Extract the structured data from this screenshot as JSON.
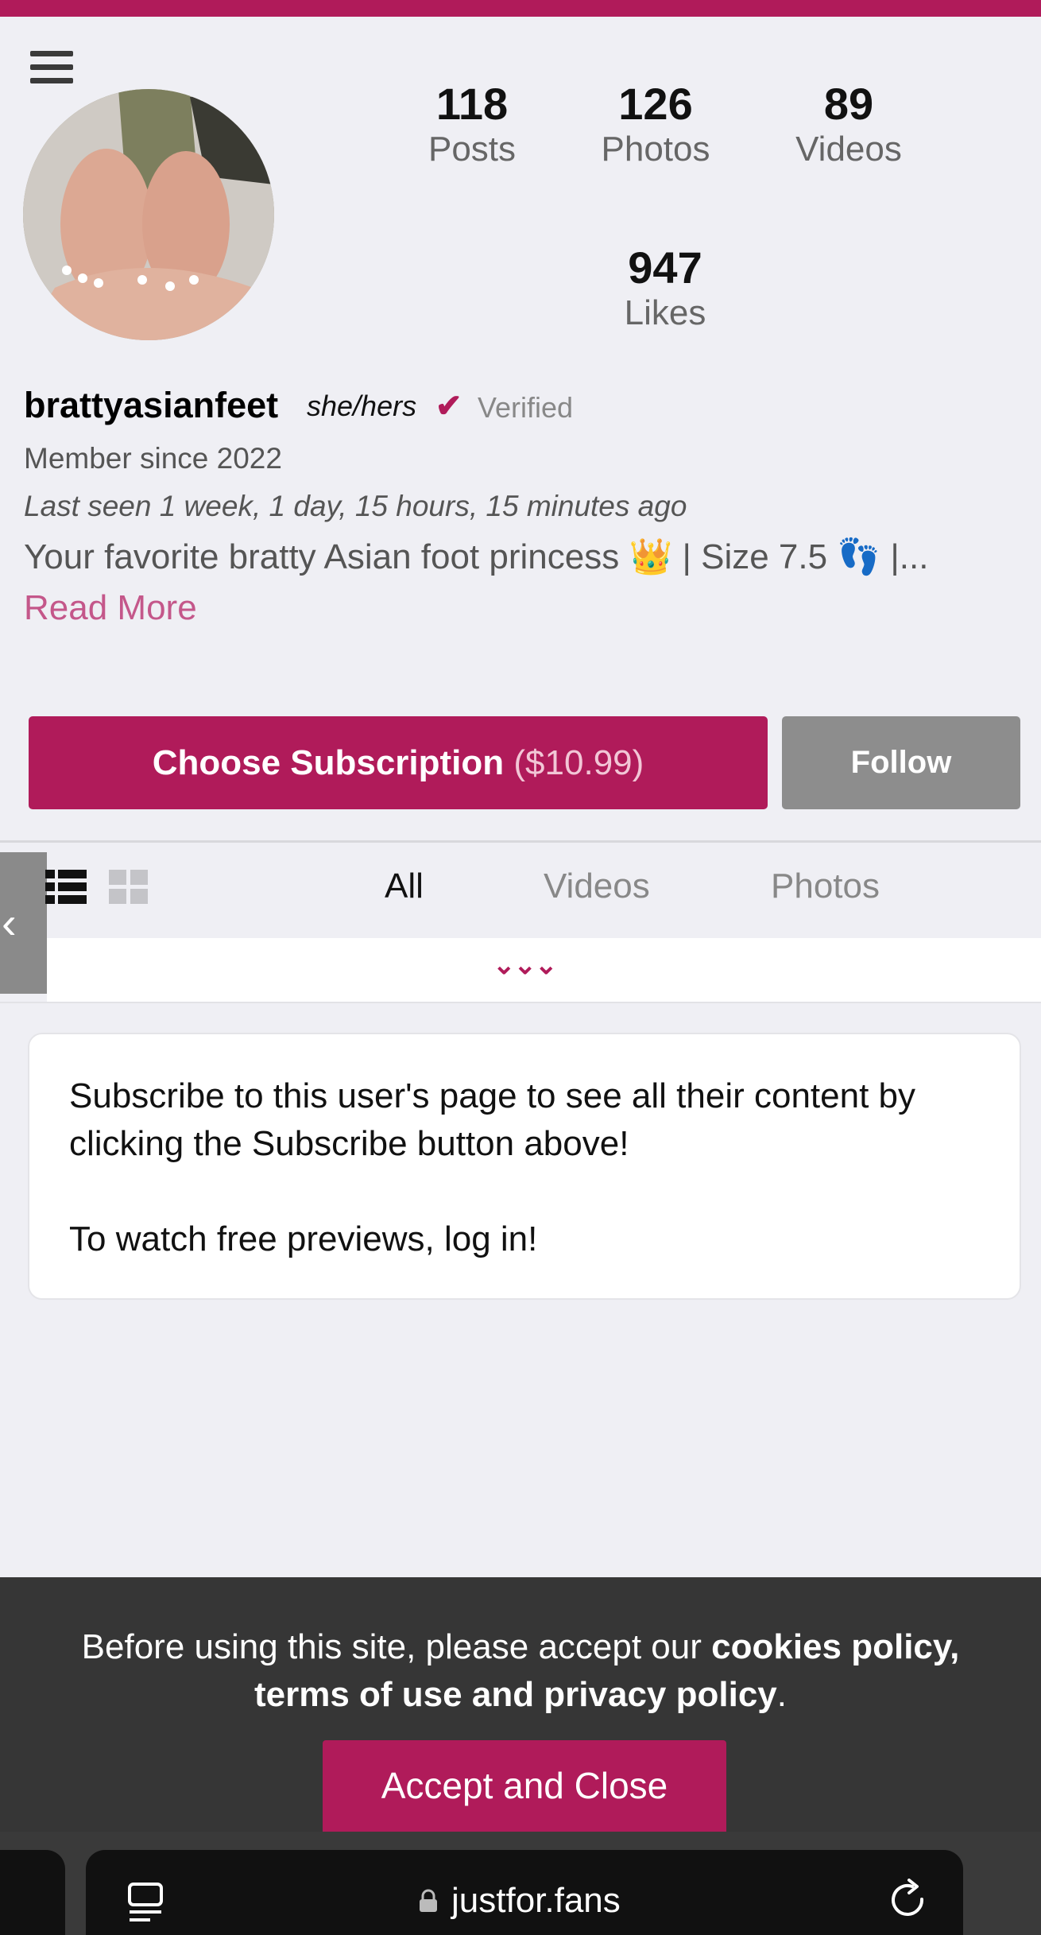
{
  "profile": {
    "stats": [
      {
        "value": "118",
        "label": "Posts"
      },
      {
        "value": "126",
        "label": "Photos"
      },
      {
        "value": "89",
        "label": "Videos"
      },
      {
        "value": "947",
        "label": "Likes"
      }
    ],
    "username": "brattyasianfeet",
    "pronouns": "she/hers",
    "verified_label": "Verified",
    "member_since": "Member since 2022",
    "last_seen": "Last seen 1 week, 1 day, 15 hours, 15 minutes ago",
    "bio": "Your favorite bratty Asian foot princess 👑 | Size 7.5 👣 |...",
    "read_more": "Read More"
  },
  "actions": {
    "subscribe_label": "Choose Subscription",
    "subscribe_price": "($10.99)",
    "follow_label": "Follow"
  },
  "filters": {
    "tabs": [
      "All",
      "Videos",
      "Photos"
    ],
    "active": "All"
  },
  "content_notice": {
    "line1": "Subscribe to this user's page to see all their content by clicking the Subscribe button above!",
    "line2": "To watch free previews, log in!"
  },
  "cookie": {
    "text_start": "Before using this site, please accept our ",
    "text_bold": "cookies policy, terms of use and privacy policy",
    "text_end": ".",
    "accept_label": "Accept and Close"
  },
  "browser": {
    "url": "justfor.fans"
  },
  "colors": {
    "accent": "#b01b5a",
    "follow_bg": "#8d8d8d",
    "cookie_bg": "#363636"
  }
}
